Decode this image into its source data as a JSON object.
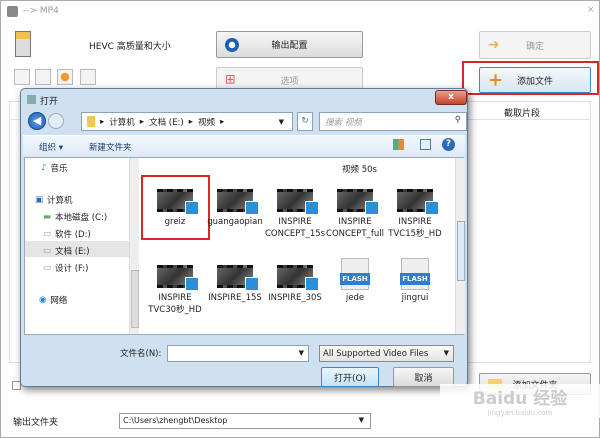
{
  "window": {
    "title": "--> MP4",
    "close": "×"
  },
  "profile": {
    "label": "HEVC 高质量和大小"
  },
  "buttons": {
    "output_config": "输出配置",
    "ok": "确定",
    "options": "选项",
    "add_file": "添加文件",
    "add_folder": "添加文件夹"
  },
  "table": {
    "clip_header": "截取片段"
  },
  "output": {
    "label": "输出文件夹",
    "path": "C:\\Users\\zhengbt\\Desktop"
  },
  "dialog": {
    "title": "打开",
    "breadcrumb": [
      "计算机",
      "文档 (E:)",
      "视频"
    ],
    "search_placeholder": "搜索 视频",
    "organize": "组织 ▾",
    "new_folder": "新建文件夹",
    "nav": [
      {
        "label": "音乐"
      },
      {
        "label": "计算机"
      },
      {
        "label": "本地磁盘 (C:)"
      },
      {
        "label": "软件 (D:)"
      },
      {
        "label": "文档 (E:)"
      },
      {
        "label": "设计 (F:)"
      },
      {
        "label": "网络"
      }
    ],
    "partial_top_label": "视频 50s",
    "files": [
      {
        "name": "greiz",
        "type": "video"
      },
      {
        "name": "guangaopian",
        "type": "video"
      },
      {
        "name": "INSPIRE CONCEPT_15s",
        "type": "video"
      },
      {
        "name": "INSPIRE CONCEPT_full",
        "type": "video"
      },
      {
        "name": "INSPIRE TVC15秒_HD",
        "type": "video"
      },
      {
        "name": "INSPIRE TVC30秒_HD",
        "type": "video"
      },
      {
        "name": "INSPIRE_15S",
        "type": "video"
      },
      {
        "name": "INSPIRE_30S",
        "type": "video"
      },
      {
        "name": "jede",
        "type": "flash"
      },
      {
        "name": "jingrui",
        "type": "flash"
      }
    ],
    "flash_badge": "FLASH",
    "filename_label": "文件名(N):",
    "filename_value": "",
    "filter": "All Supported Video Files",
    "open": "打开(O)",
    "cancel": "取消"
  },
  "watermark": {
    "text": "Baidu 经验",
    "url": "jingyan.baidu.com"
  },
  "colors": {
    "highlight": "#d9262b",
    "accent": "#2a8ed8"
  }
}
